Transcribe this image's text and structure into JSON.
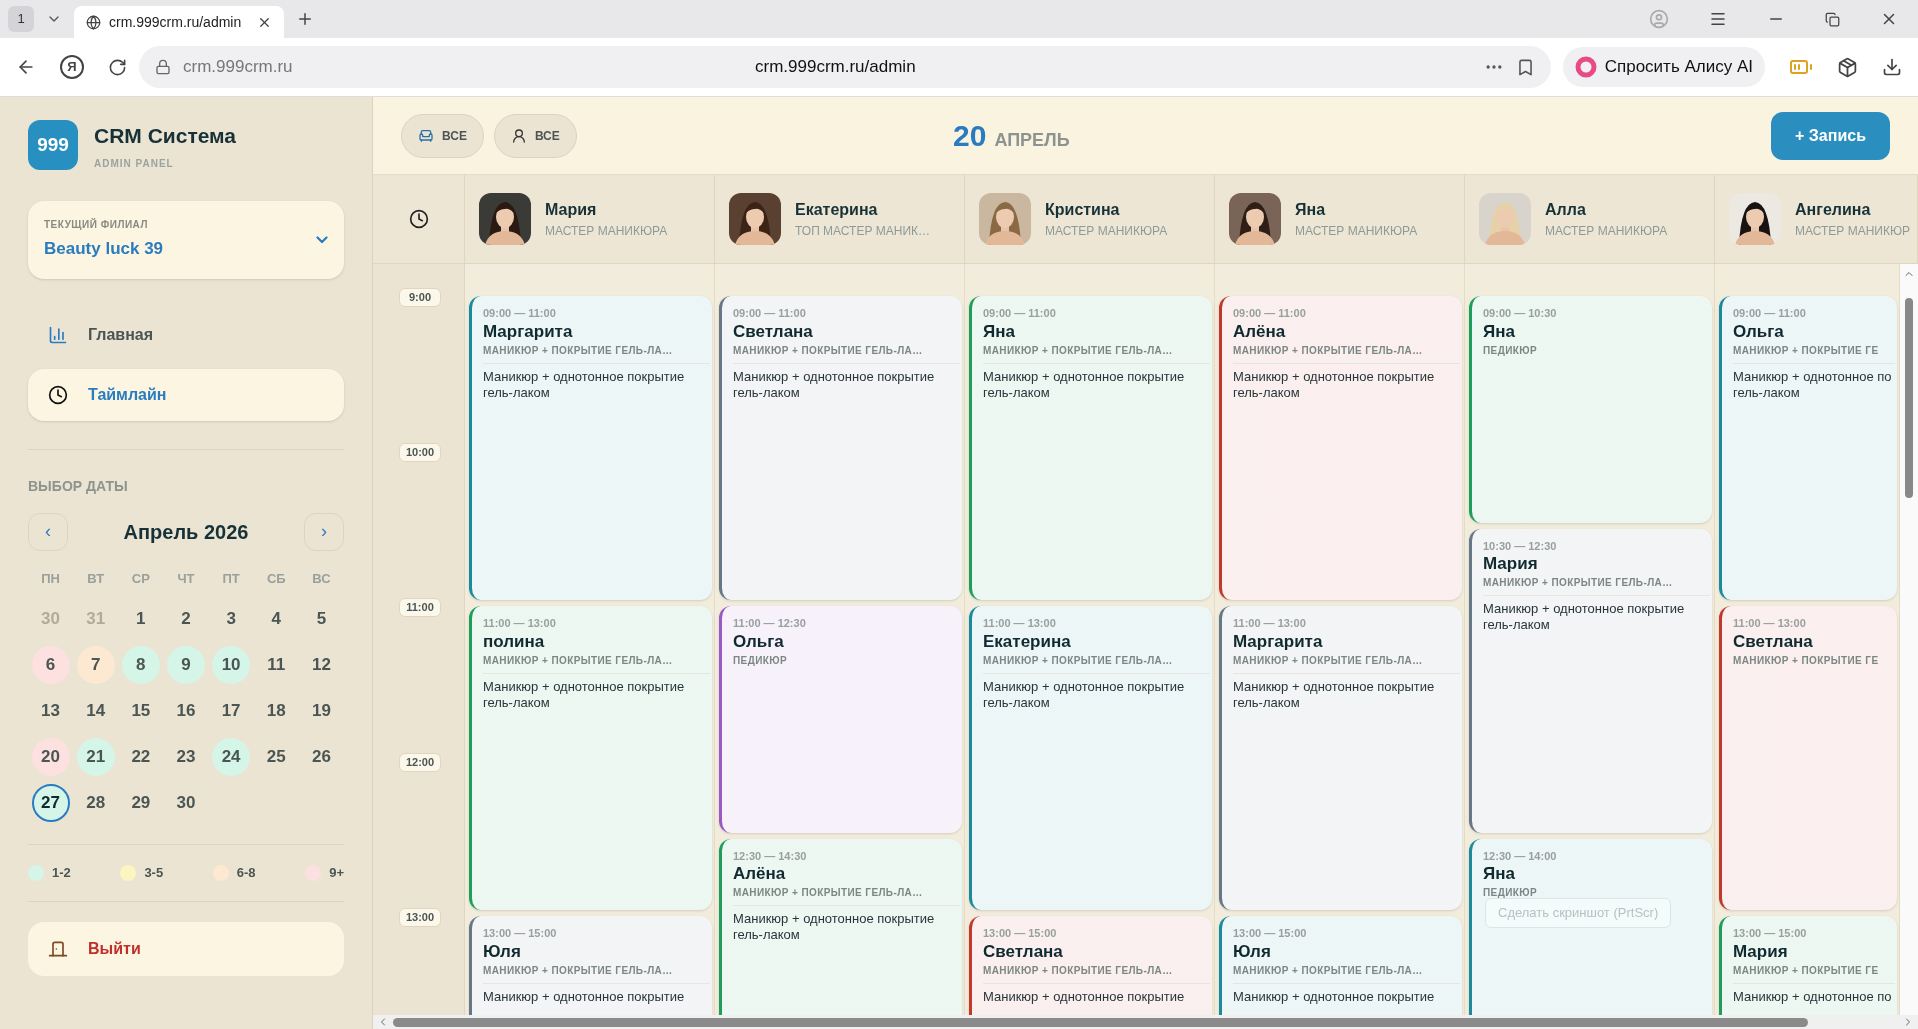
{
  "browser": {
    "tab_count": "1",
    "tab_title": "crm.999crm.ru/admin",
    "logo": "Я",
    "address_host": "crm.999crm.ru",
    "address_url": "crm.999crm.ru/admin",
    "alice_button": "Спросить Алису AI"
  },
  "sidebar": {
    "logo": "999",
    "title": "CRM Система",
    "subtitle": "ADMIN PANEL",
    "branch": {
      "label": "ТЕКУЩИЙ ФИЛИАЛ",
      "value": "Beauty luck 39"
    },
    "nav": [
      {
        "kind": "chart",
        "label": "Главная",
        "selected": false
      },
      {
        "kind": "clock",
        "label": "Таймлайн",
        "selected": true
      }
    ],
    "date_picker": {
      "title": "ВЫБОР ДАТЫ",
      "prev": "‹",
      "next": "›",
      "month": "Апрель 2026",
      "weekdays": [
        "ПН",
        "ВТ",
        "СР",
        "ЧТ",
        "ПТ",
        "СБ",
        "ВС"
      ],
      "days": [
        {
          "label": "30",
          "muted": true,
          "selected": false
        },
        {
          "label": "31",
          "muted": true,
          "selected": false
        },
        {
          "label": "1",
          "muted": false,
          "selected": false
        },
        {
          "label": "2",
          "muted": false,
          "selected": false
        },
        {
          "label": "3",
          "muted": false,
          "selected": false
        },
        {
          "label": "4",
          "muted": false,
          "selected": false
        },
        {
          "label": "5",
          "muted": false,
          "selected": false
        },
        {
          "label": "6",
          "muted": false,
          "selected": false,
          "color": "#fde0e0"
        },
        {
          "label": "7",
          "muted": false,
          "selected": false,
          "color": "#fde8d2"
        },
        {
          "label": "8",
          "muted": false,
          "selected": false,
          "color": "#d4f5e7"
        },
        {
          "label": "9",
          "muted": false,
          "selected": false,
          "color": "#d4f5e7"
        },
        {
          "label": "10",
          "muted": false,
          "selected": false,
          "color": "#d4f5e7"
        },
        {
          "label": "11",
          "muted": false,
          "selected": false
        },
        {
          "label": "12",
          "muted": false,
          "selected": false
        },
        {
          "label": "13",
          "muted": false,
          "selected": false
        },
        {
          "label": "14",
          "muted": false,
          "selected": false
        },
        {
          "label": "15",
          "muted": false,
          "selected": false
        },
        {
          "label": "16",
          "muted": false,
          "selected": false
        },
        {
          "label": "17",
          "muted": false,
          "selected": false
        },
        {
          "label": "18",
          "muted": false,
          "selected": false
        },
        {
          "label": "19",
          "muted": false,
          "selected": false
        },
        {
          "label": "20",
          "muted": false,
          "selected": false,
          "color": "#fde0e0"
        },
        {
          "label": "21",
          "muted": false,
          "selected": false,
          "color": "#d4f5e7"
        },
        {
          "label": "22",
          "muted": false,
          "selected": false
        },
        {
          "label": "23",
          "muted": false,
          "selected": false
        },
        {
          "label": "24",
          "muted": false,
          "selected": false,
          "color": "#d4f5e7"
        },
        {
          "label": "25",
          "muted": false,
          "selected": false
        },
        {
          "label": "26",
          "muted": false,
          "selected": false
        },
        {
          "label": "27",
          "muted": false,
          "selected": true,
          "color": "#d4f5e7"
        },
        {
          "label": "28",
          "muted": false,
          "selected": false
        },
        {
          "label": "29",
          "muted": false,
          "selected": false
        },
        {
          "label": "30",
          "muted": false,
          "selected": false
        }
      ]
    },
    "legend": [
      {
        "label": "1-2",
        "color": "#d4f5e7"
      },
      {
        "label": "3-5",
        "color": "#fbf6bf"
      },
      {
        "label": "6-8",
        "color": "#fde8d2"
      },
      {
        "label": "9+",
        "color": "#fde0e0"
      }
    ],
    "logout": "Выйти"
  },
  "header": {
    "filters": [
      {
        "kind": "seat",
        "label": "ВСЕ"
      },
      {
        "kind": "person",
        "label": "ВСЕ"
      }
    ],
    "day": "20",
    "month": "АПРЕЛЬ",
    "add_button": "+ Запись"
  },
  "timeline": {
    "hours": [
      "9:00",
      "10:00",
      "11:00",
      "12:00",
      "13:00"
    ],
    "masters": [
      {
        "name": "Мария",
        "role": "МАСТЕР МАНИКЮРА",
        "appointments": [
          {
            "time": "09:00 — 11:00",
            "client": "Маргарита",
            "service": "МАНИКЮР + ПОКРЫТИЕ ГЕЛЬ-ЛА…",
            "note": [
              "Маникюр + однотонное покрытие",
              "гель-лаком"
            ],
            "color": "#1a8a9c"
          },
          {
            "time": "11:00 — 13:00",
            "client": "полина",
            "service": "МАНИКЮР + ПОКРЫТИЕ ГЕЛЬ-ЛА…",
            "note": [
              "Маникюр + однотонное покрытие",
              "гель-лаком"
            ],
            "color": "#1e9e5a"
          },
          {
            "time": "13:00 — 15:00",
            "client": "Юля",
            "service": "МАНИКЮР + ПОКРЫТИЕ ГЕЛЬ-ЛА…",
            "note": [
              "Маникюр + однотонное покрытие"
            ],
            "color": "#667788"
          }
        ]
      },
      {
        "name": "Екатерина",
        "role": "ТОП МАСТЕР МАНИК…",
        "appointments": [
          {
            "time": "09:00 — 11:00",
            "client": "Светлана",
            "service": "МАНИКЮР + ПОКРЫТИЕ ГЕЛЬ-ЛА…",
            "note": [
              "Маникюр + однотонное покрытие",
              "гель-лаком"
            ],
            "color": "#667788"
          },
          {
            "time": "11:00 — 12:30",
            "client": "Ольга",
            "service": "ПЕДИКЮР",
            "color": "#9b59c6"
          },
          {
            "time": "12:30 — 14:30",
            "client": "Алёна",
            "service": "МАНИКЮР + ПОКРЫТИЕ ГЕЛЬ-ЛА…",
            "note": [
              "Маникюр + однотонное покрытие",
              "гель-лаком"
            ],
            "color": "#1e9e5a"
          }
        ]
      },
      {
        "name": "Кристина",
        "role": "МАСТЕР МАНИКЮРА",
        "appointments": [
          {
            "time": "09:00 — 11:00",
            "client": "Яна",
            "service": "МАНИКЮР + ПОКРЫТИЕ ГЕЛЬ-ЛА…",
            "note": [
              "Маникюр + однотонное покрытие",
              "гель-лаком"
            ],
            "color": "#1e9e5a"
          },
          {
            "time": "11:00 — 13:00",
            "client": "Екатерина",
            "service": "МАНИКЮР + ПОКРЫТИЕ ГЕЛЬ-ЛА…",
            "note": [
              "Маникюр + однотонное покрытие",
              "гель-лаком"
            ],
            "color": "#1a8a9c"
          },
          {
            "time": "13:00 — 15:00",
            "client": "Светлана",
            "service": "МАНИКЮР + ПОКРЫТИЕ ГЕЛЬ-ЛА…",
            "note": [
              "Маникюр + однотонное покрытие"
            ],
            "color": "#c0392b"
          }
        ]
      },
      {
        "name": "Яна",
        "role": "МАСТЕР МАНИКЮРА",
        "appointments": [
          {
            "time": "09:00 — 11:00",
            "client": "Алёна",
            "service": "МАНИКЮР + ПОКРЫТИЕ ГЕЛЬ-ЛА…",
            "note": [
              "Маникюр + однотонное покрытие",
              "гель-лаком"
            ],
            "color": "#c0392b"
          },
          {
            "time": "11:00 — 13:00",
            "client": "Маргарита",
            "service": "МАНИКЮР + ПОКРЫТИЕ ГЕЛЬ-ЛА…",
            "note": [
              "Маникюр + однотонное покрытие",
              "гель-лаком"
            ],
            "color": "#667788"
          },
          {
            "time": "13:00 — 15:00",
            "client": "Юля",
            "service": "МАНИКЮР + ПОКРЫТИЕ ГЕЛЬ-ЛА…",
            "note": [
              "Маникюр + однотонное покрытие"
            ],
            "color": "#1a8a9c"
          }
        ]
      },
      {
        "name": "Алла",
        "role": "МАСТЕР МАНИКЮРА",
        "appointments": [
          {
            "time": "09:00 — 10:30",
            "client": "Яна",
            "service": "ПЕДИКЮР",
            "color": "#1e9e5a"
          },
          {
            "time": "10:30 — 12:30",
            "client": "Мария",
            "service": "МАНИКЮР + ПОКРЫТИЕ ГЕЛЬ-ЛА…",
            "note": [
              "Маникюр + однотонное покрытие",
              "гель-лаком"
            ],
            "color": "#667788"
          },
          {
            "time": "12:30 — 14:00",
            "client": "Яна",
            "service": "ПЕДИКЮР",
            "color": "#1a8a9c"
          }
        ]
      },
      {
        "name": "Ангелина",
        "role": "МАСТЕР МАНИКЮР",
        "appointments": [
          {
            "time": "09:00 — 11:00",
            "client": "Ольга",
            "service": "МАНИКЮР + ПОКРЫТИЕ ГЕ",
            "note": [
              "Маникюр + однотонное по",
              "гель-лаком"
            ],
            "color": "#1a8a9c"
          },
          {
            "time": "11:00 — 13:00",
            "client": "Светлана",
            "service": "МАНИКЮР + ПОКРЫТИЕ ГЕ",
            "color": "#c0392b"
          },
          {
            "time": "13:00 — 15:00",
            "client": "Мария",
            "service": "МАНИКЮР + ПОКРЫТИЕ ГЕ",
            "note": [
              "Маникюр + однотонное по"
            ],
            "color": "#1e9e5a"
          }
        ]
      }
    ]
  },
  "tooltip": "Сделать скриншот (PrtScr)"
}
